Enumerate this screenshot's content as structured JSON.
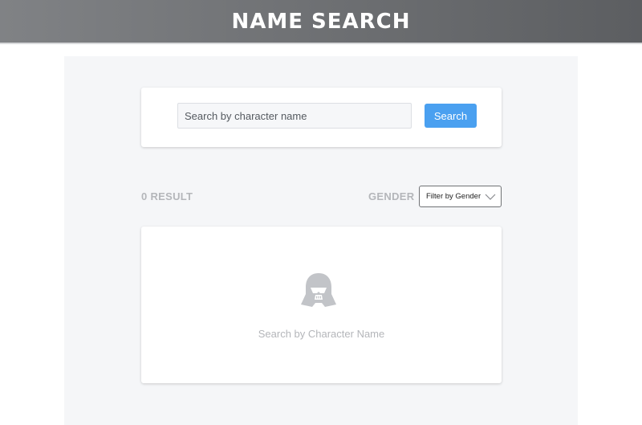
{
  "header": {
    "title": "NAME SEARCH"
  },
  "search": {
    "placeholder": "Search by character name",
    "value": "",
    "button_label": "Search"
  },
  "results": {
    "count_label": "0 RESULT",
    "gender_label": "GENDER",
    "gender_select_value": "Filter by Gender",
    "empty_icon": "helmet-icon",
    "empty_message": "Search by Character Name"
  },
  "colors": {
    "accent": "#4aa0f0",
    "header_bg": "#6e7073",
    "panel_bg": "#f5f6f8",
    "muted_text": "#b4b6ba"
  }
}
